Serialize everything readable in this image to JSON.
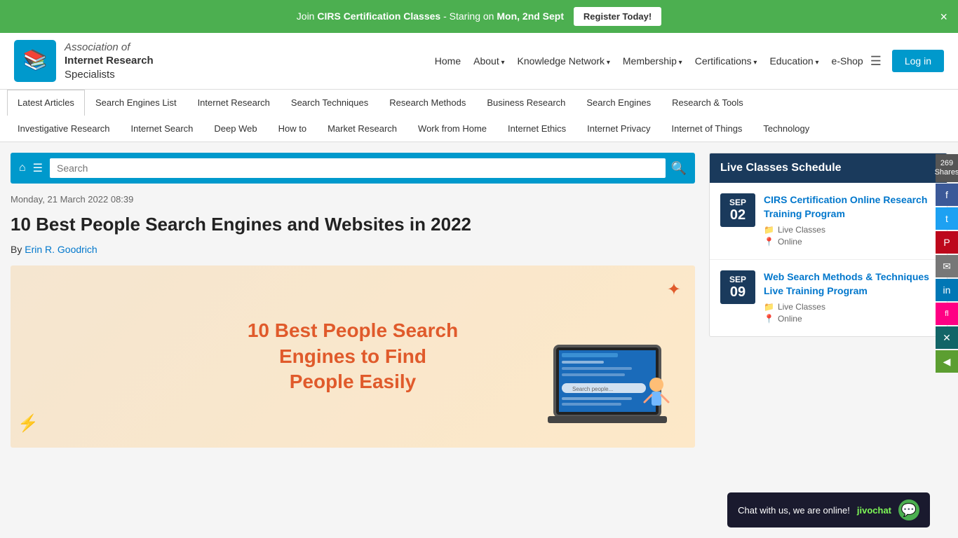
{
  "banner": {
    "text_pre": "Join ",
    "text_bold": "CIRS Certification Classes",
    "text_mid": " - Staring on ",
    "text_bold2": "Mon, 2nd Sept",
    "register_label": "Register Today!",
    "close_label": "×"
  },
  "header": {
    "logo_line1": "Association of",
    "logo_line2": "Internet Research",
    "logo_line3": "Specialists",
    "nav": [
      {
        "label": "Home",
        "has_arrow": false
      },
      {
        "label": "About",
        "has_arrow": true
      },
      {
        "label": "Knowledge Network",
        "has_arrow": true
      },
      {
        "label": "Membership",
        "has_arrow": true
      },
      {
        "label": "Certifications",
        "has_arrow": true
      },
      {
        "label": "Education",
        "has_arrow": true
      },
      {
        "label": "e-Shop",
        "has_arrow": false
      }
    ],
    "login_label": "Log in"
  },
  "cat_nav": {
    "row1": [
      {
        "label": "Latest Articles",
        "active": true
      },
      {
        "label": "Search Engines List"
      },
      {
        "label": "Internet Research"
      },
      {
        "label": "Search Techniques"
      },
      {
        "label": "Research Methods"
      },
      {
        "label": "Business Research"
      },
      {
        "label": "Search Engines"
      },
      {
        "label": "Research & Tools"
      }
    ],
    "row2": [
      {
        "label": "Investigative Research"
      },
      {
        "label": "Internet Search"
      },
      {
        "label": "Deep Web"
      },
      {
        "label": "How to"
      },
      {
        "label": "Market Research"
      },
      {
        "label": "Work from Home"
      },
      {
        "label": "Internet Ethics"
      },
      {
        "label": "Internet Privacy"
      },
      {
        "label": "Internet of Things"
      },
      {
        "label": "Technology"
      }
    ]
  },
  "social": {
    "shares_count": "269",
    "shares_label": "Shares",
    "buttons": [
      {
        "name": "facebook",
        "class": "fb",
        "icon": "f"
      },
      {
        "name": "twitter",
        "class": "tw",
        "icon": "t"
      },
      {
        "name": "pinterest",
        "class": "pi",
        "icon": "p"
      },
      {
        "name": "email",
        "class": "em",
        "icon": "✉"
      },
      {
        "name": "linkedin",
        "class": "li",
        "icon": "in"
      },
      {
        "name": "flipboard",
        "class": "fl",
        "icon": "fl"
      },
      {
        "name": "xing",
        "class": "xg",
        "icon": "x"
      },
      {
        "name": "sharethis",
        "class": "sh",
        "icon": "◀"
      }
    ]
  },
  "search": {
    "placeholder": "Search",
    "home_icon": "⌂",
    "menu_icon": "☰",
    "search_icon": "🔍"
  },
  "article": {
    "date": "Monday, 21 March 2022 08:39",
    "title": "10 Best People Search Engines and Websites in 2022",
    "author_prefix": "By",
    "author_name": "Erin R. Goodrich",
    "image_text": "10 Best People Search\nEngines to Find\nPeople Easily"
  },
  "sidebar": {
    "live_classes_title": "Live Classes Schedule",
    "schedule": [
      {
        "month": "SEP",
        "day": "02",
        "title": "CIRS Certification Online Research Training Program",
        "category": "Live Classes",
        "location": "Online"
      },
      {
        "month": "SEP",
        "day": "09",
        "title": "Web Search Methods & Techniques Live Training Program",
        "category": "Live Classes",
        "location": "Online"
      }
    ]
  },
  "chat": {
    "text": "Chat with us, we are online!",
    "brand": "jivochat"
  }
}
